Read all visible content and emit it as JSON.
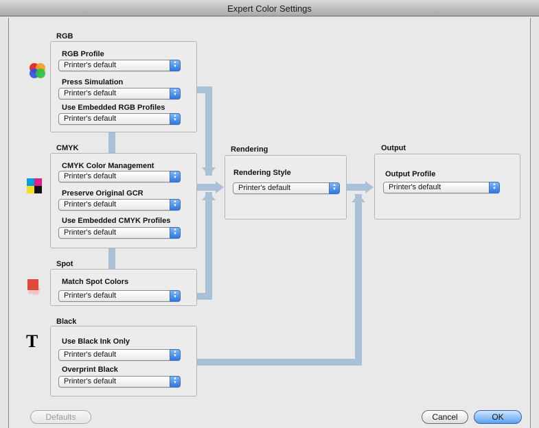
{
  "window": {
    "title": "Expert Color Settings"
  },
  "sections": {
    "rgb": {
      "title": "RGB",
      "fields": [
        {
          "label": "RGB Profile",
          "value": "Printer's default"
        },
        {
          "label": "Press Simulation",
          "value": "Printer's default"
        },
        {
          "label": "Use Embedded RGB Profiles",
          "value": "Printer's default"
        }
      ]
    },
    "cmyk": {
      "title": "CMYK",
      "fields": [
        {
          "label": "CMYK Color Management",
          "value": "Printer's default"
        },
        {
          "label": "Preserve Original GCR",
          "value": "Printer's default"
        },
        {
          "label": "Use Embedded CMYK Profiles",
          "value": "Printer's default"
        }
      ]
    },
    "spot": {
      "title": "Spot",
      "fields": [
        {
          "label": "Match Spot Colors",
          "value": "Printer's default"
        }
      ]
    },
    "black": {
      "title": "Black",
      "icon_text": "T",
      "fields": [
        {
          "label": "Use Black Ink Only",
          "value": "Printer's default"
        },
        {
          "label": "Overprint Black",
          "value": "Printer's default"
        }
      ]
    },
    "rendering": {
      "title": "Rendering",
      "fields": [
        {
          "label": "Rendering Style",
          "value": "Printer's default"
        }
      ]
    },
    "output": {
      "title": "Output",
      "fields": [
        {
          "label": "Output Profile",
          "value": "Printer's default"
        }
      ]
    }
  },
  "buttons": {
    "defaults": "Defaults",
    "cancel": "Cancel",
    "ok": "OK"
  },
  "colors": {
    "pipe": "#a9c1d6",
    "accent": "#3b7de0"
  }
}
